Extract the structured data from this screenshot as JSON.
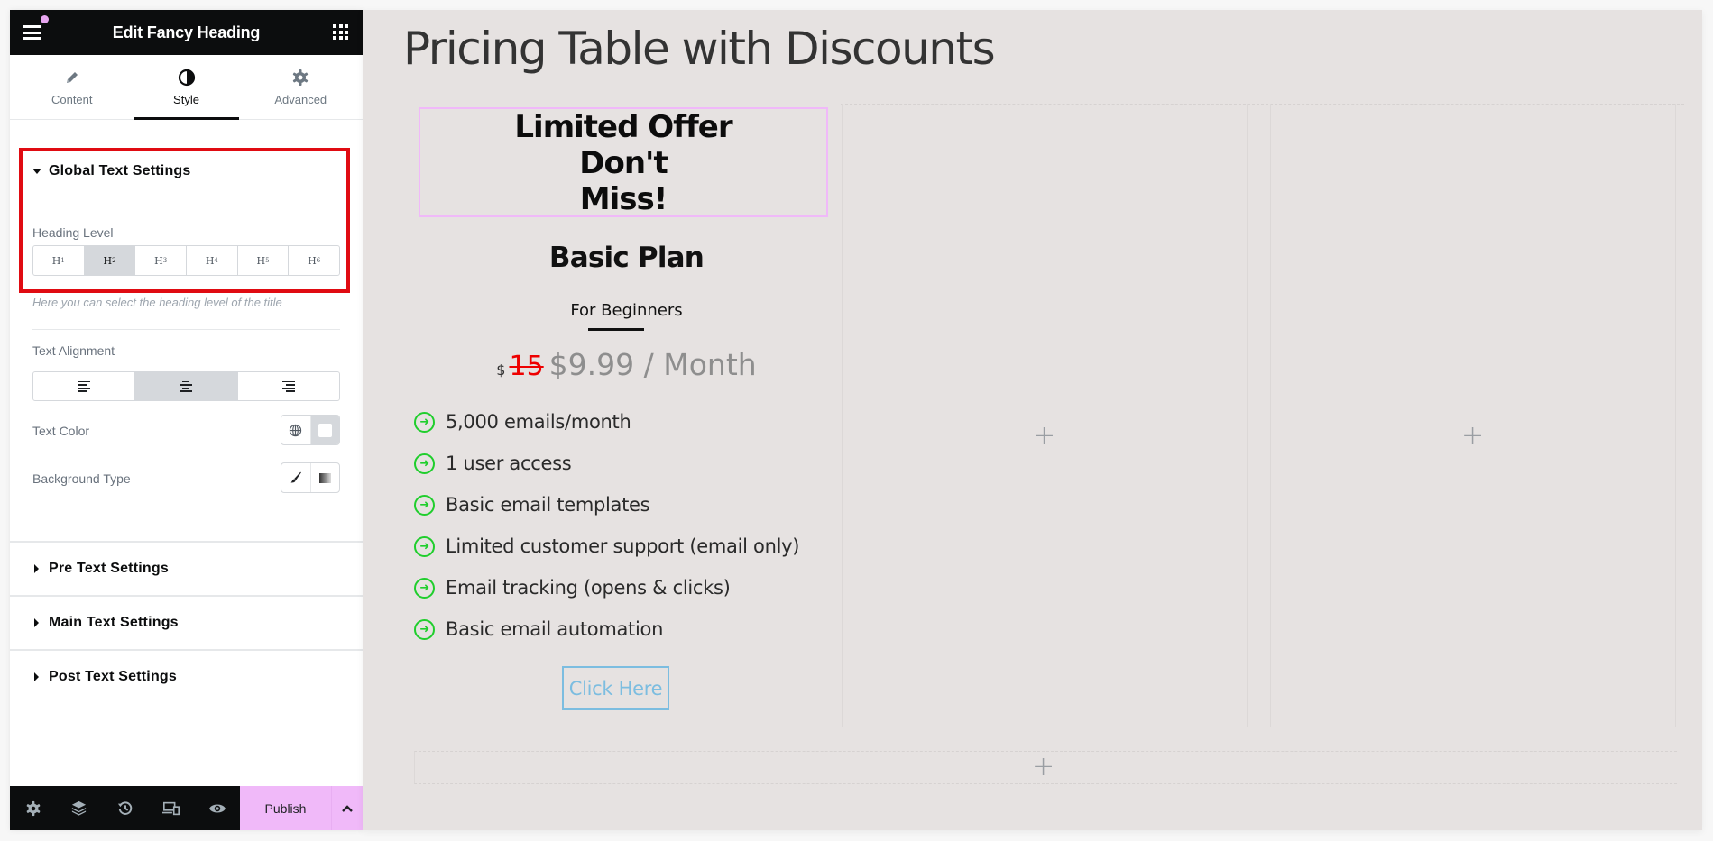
{
  "panel": {
    "title": "Edit Fancy Heading",
    "tabs": [
      {
        "label": "Content",
        "icon": "pencil-icon"
      },
      {
        "label": "Style",
        "icon": "half-circle-icon",
        "active": true
      },
      {
        "label": "Advanced",
        "icon": "gear-icon"
      }
    ],
    "global_section": {
      "title": "Global Text Settings",
      "heading_level_label": "Heading Level",
      "heading_levels": [
        "H1",
        "H2",
        "H3",
        "H4",
        "H5",
        "H6"
      ],
      "selected_heading_level": "H2",
      "heading_level_hint": "Here you can select the heading level of the title",
      "text_alignment_label": "Text Alignment",
      "text_alignment_options": [
        "left",
        "center",
        "right"
      ],
      "selected_alignment": "center",
      "text_color_label": "Text Color",
      "background_type_label": "Background Type"
    },
    "collapsed_sections": [
      "Pre Text Settings",
      "Main Text Settings",
      "Post Text Settings"
    ],
    "bottom_bar": {
      "icons": [
        "settings-icon",
        "layers-icon",
        "history-icon",
        "responsive-icon",
        "preview-eye-icon"
      ],
      "publish_label": "Publish"
    },
    "accent_color": "#f0b9f9",
    "highlight_color": "#e00b12"
  },
  "canvas": {
    "page_title": "Pricing Table with Discounts",
    "fancy_heading": [
      "Limited Offer",
      "Don't",
      "Miss!"
    ],
    "plan": {
      "title": "Basic Plan",
      "subtitle": "For Beginners",
      "currency": "$",
      "old_price": "15",
      "new_price": "$9.99 / Month",
      "features": [
        "5,000 emails/month",
        "1 user access",
        "Basic email templates",
        "Limited customer support (email only)",
        "Email tracking (opens & clicks)",
        "Basic email automation"
      ],
      "button_label": "Click Here"
    },
    "add_element_symbol": "+"
  }
}
